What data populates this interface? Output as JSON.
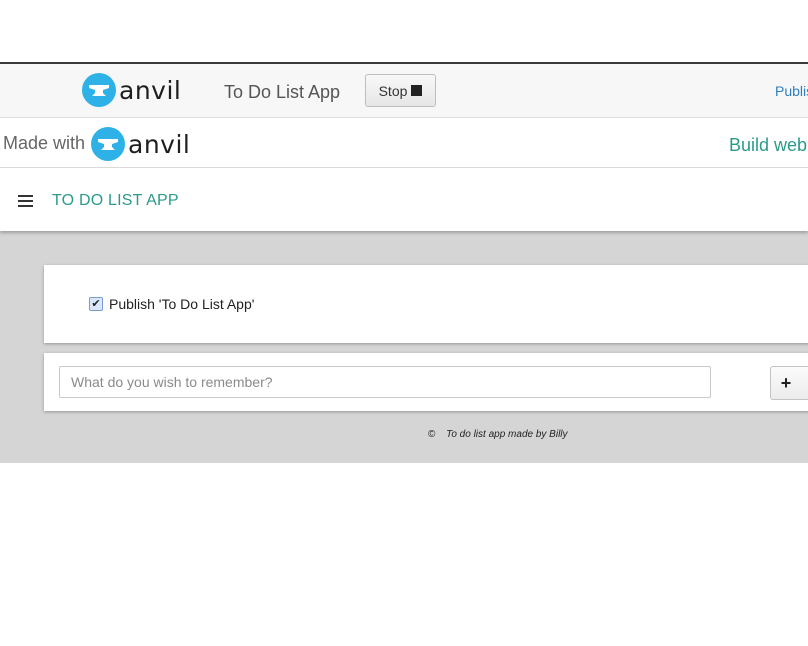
{
  "ide_bar": {
    "logo_text": "anvil",
    "app_name": "To Do List App",
    "stop_label": "Stop",
    "publish_label": "Publis"
  },
  "made_bar": {
    "made_with": "Made with",
    "logo_text": "anvil",
    "build_label": "Build web"
  },
  "app": {
    "title": "TO DO LIST APP",
    "publish_checkbox_label": "Publish 'To Do List App'",
    "publish_checked": true,
    "input_placeholder": "What do you wish to remember?",
    "add_button": "+",
    "footer_copyright": "©",
    "footer_text": "To do list app made by Billy"
  },
  "colors": {
    "accent": "#2b9a8a",
    "anvil_blue": "#2eb1e6",
    "link": "#2f7ec0"
  }
}
